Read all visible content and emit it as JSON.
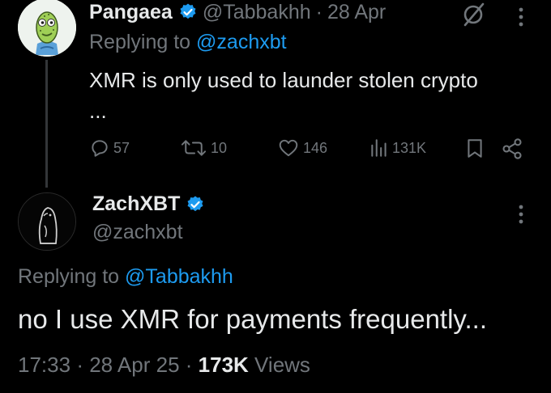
{
  "reply": {
    "author_name": "Pangaea",
    "author_handle": "@Tabbakhh",
    "separator": "·",
    "date": "28 Apr",
    "replying_prefix": "Replying to ",
    "replying_to": "@zachxbt",
    "text": "XMR is only used to launder stolen crypto ...",
    "stats": {
      "replies": "57",
      "reposts": "10",
      "likes": "146",
      "views": "131K"
    }
  },
  "main": {
    "author_name": "ZachXBT",
    "author_handle": "@zachxbt",
    "replying_prefix": "Replying to ",
    "replying_to": "@Tabbakhh",
    "text": "no I use XMR for payments frequently...",
    "time": "17:33",
    "separator": "·",
    "date": "28 Apr 25",
    "views_count": "173K",
    "views_label": " Views"
  },
  "icons": {
    "verified": "verified-badge-icon",
    "grok": "grok-slash-icon",
    "more": "more-vertical-icon",
    "reply": "reply-icon",
    "repost": "repost-icon",
    "like": "heart-icon",
    "views": "views-bar-chart-icon",
    "bookmark": "bookmark-icon",
    "share": "share-icon"
  },
  "colors": {
    "background": "#000000",
    "text": "#e7e9ea",
    "muted": "#71767b",
    "accent": "#1d9bf0"
  }
}
